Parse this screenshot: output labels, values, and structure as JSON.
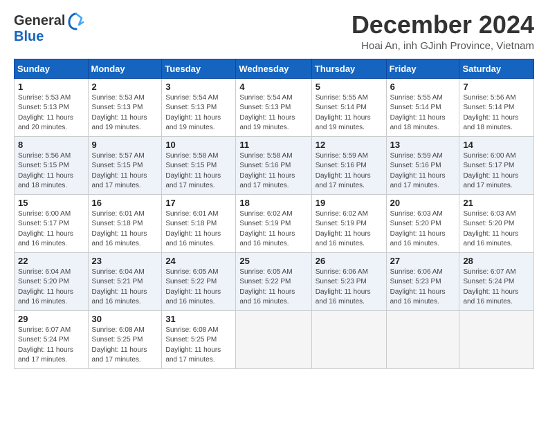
{
  "logo": {
    "general": "General",
    "blue": "Blue"
  },
  "title": "December 2024",
  "subtitle": "Hoai An, inh GJinh Province, Vietnam",
  "days_of_week": [
    "Sunday",
    "Monday",
    "Tuesday",
    "Wednesday",
    "Thursday",
    "Friday",
    "Saturday"
  ],
  "weeks": [
    [
      {
        "day": "1",
        "sunrise": "5:53 AM",
        "sunset": "5:13 PM",
        "daylight": "11 hours and 20 minutes."
      },
      {
        "day": "2",
        "sunrise": "5:53 AM",
        "sunset": "5:13 PM",
        "daylight": "11 hours and 19 minutes."
      },
      {
        "day": "3",
        "sunrise": "5:54 AM",
        "sunset": "5:13 PM",
        "daylight": "11 hours and 19 minutes."
      },
      {
        "day": "4",
        "sunrise": "5:54 AM",
        "sunset": "5:13 PM",
        "daylight": "11 hours and 19 minutes."
      },
      {
        "day": "5",
        "sunrise": "5:55 AM",
        "sunset": "5:14 PM",
        "daylight": "11 hours and 19 minutes."
      },
      {
        "day": "6",
        "sunrise": "5:55 AM",
        "sunset": "5:14 PM",
        "daylight": "11 hours and 18 minutes."
      },
      {
        "day": "7",
        "sunrise": "5:56 AM",
        "sunset": "5:14 PM",
        "daylight": "11 hours and 18 minutes."
      }
    ],
    [
      {
        "day": "8",
        "sunrise": "5:56 AM",
        "sunset": "5:15 PM",
        "daylight": "11 hours and 18 minutes."
      },
      {
        "day": "9",
        "sunrise": "5:57 AM",
        "sunset": "5:15 PM",
        "daylight": "11 hours and 17 minutes."
      },
      {
        "day": "10",
        "sunrise": "5:58 AM",
        "sunset": "5:15 PM",
        "daylight": "11 hours and 17 minutes."
      },
      {
        "day": "11",
        "sunrise": "5:58 AM",
        "sunset": "5:16 PM",
        "daylight": "11 hours and 17 minutes."
      },
      {
        "day": "12",
        "sunrise": "5:59 AM",
        "sunset": "5:16 PM",
        "daylight": "11 hours and 17 minutes."
      },
      {
        "day": "13",
        "sunrise": "5:59 AM",
        "sunset": "5:16 PM",
        "daylight": "11 hours and 17 minutes."
      },
      {
        "day": "14",
        "sunrise": "6:00 AM",
        "sunset": "5:17 PM",
        "daylight": "11 hours and 17 minutes."
      }
    ],
    [
      {
        "day": "15",
        "sunrise": "6:00 AM",
        "sunset": "5:17 PM",
        "daylight": "11 hours and 16 minutes."
      },
      {
        "day": "16",
        "sunrise": "6:01 AM",
        "sunset": "5:18 PM",
        "daylight": "11 hours and 16 minutes."
      },
      {
        "day": "17",
        "sunrise": "6:01 AM",
        "sunset": "5:18 PM",
        "daylight": "11 hours and 16 minutes."
      },
      {
        "day": "18",
        "sunrise": "6:02 AM",
        "sunset": "5:19 PM",
        "daylight": "11 hours and 16 minutes."
      },
      {
        "day": "19",
        "sunrise": "6:02 AM",
        "sunset": "5:19 PM",
        "daylight": "11 hours and 16 minutes."
      },
      {
        "day": "20",
        "sunrise": "6:03 AM",
        "sunset": "5:20 PM",
        "daylight": "11 hours and 16 minutes."
      },
      {
        "day": "21",
        "sunrise": "6:03 AM",
        "sunset": "5:20 PM",
        "daylight": "11 hours and 16 minutes."
      }
    ],
    [
      {
        "day": "22",
        "sunrise": "6:04 AM",
        "sunset": "5:20 PM",
        "daylight": "11 hours and 16 minutes."
      },
      {
        "day": "23",
        "sunrise": "6:04 AM",
        "sunset": "5:21 PM",
        "daylight": "11 hours and 16 minutes."
      },
      {
        "day": "24",
        "sunrise": "6:05 AM",
        "sunset": "5:22 PM",
        "daylight": "11 hours and 16 minutes."
      },
      {
        "day": "25",
        "sunrise": "6:05 AM",
        "sunset": "5:22 PM",
        "daylight": "11 hours and 16 minutes."
      },
      {
        "day": "26",
        "sunrise": "6:06 AM",
        "sunset": "5:23 PM",
        "daylight": "11 hours and 16 minutes."
      },
      {
        "day": "27",
        "sunrise": "6:06 AM",
        "sunset": "5:23 PM",
        "daylight": "11 hours and 16 minutes."
      },
      {
        "day": "28",
        "sunrise": "6:07 AM",
        "sunset": "5:24 PM",
        "daylight": "11 hours and 16 minutes."
      }
    ],
    [
      {
        "day": "29",
        "sunrise": "6:07 AM",
        "sunset": "5:24 PM",
        "daylight": "11 hours and 17 minutes."
      },
      {
        "day": "30",
        "sunrise": "6:08 AM",
        "sunset": "5:25 PM",
        "daylight": "11 hours and 17 minutes."
      },
      {
        "day": "31",
        "sunrise": "6:08 AM",
        "sunset": "5:25 PM",
        "daylight": "11 hours and 17 minutes."
      },
      null,
      null,
      null,
      null
    ]
  ]
}
